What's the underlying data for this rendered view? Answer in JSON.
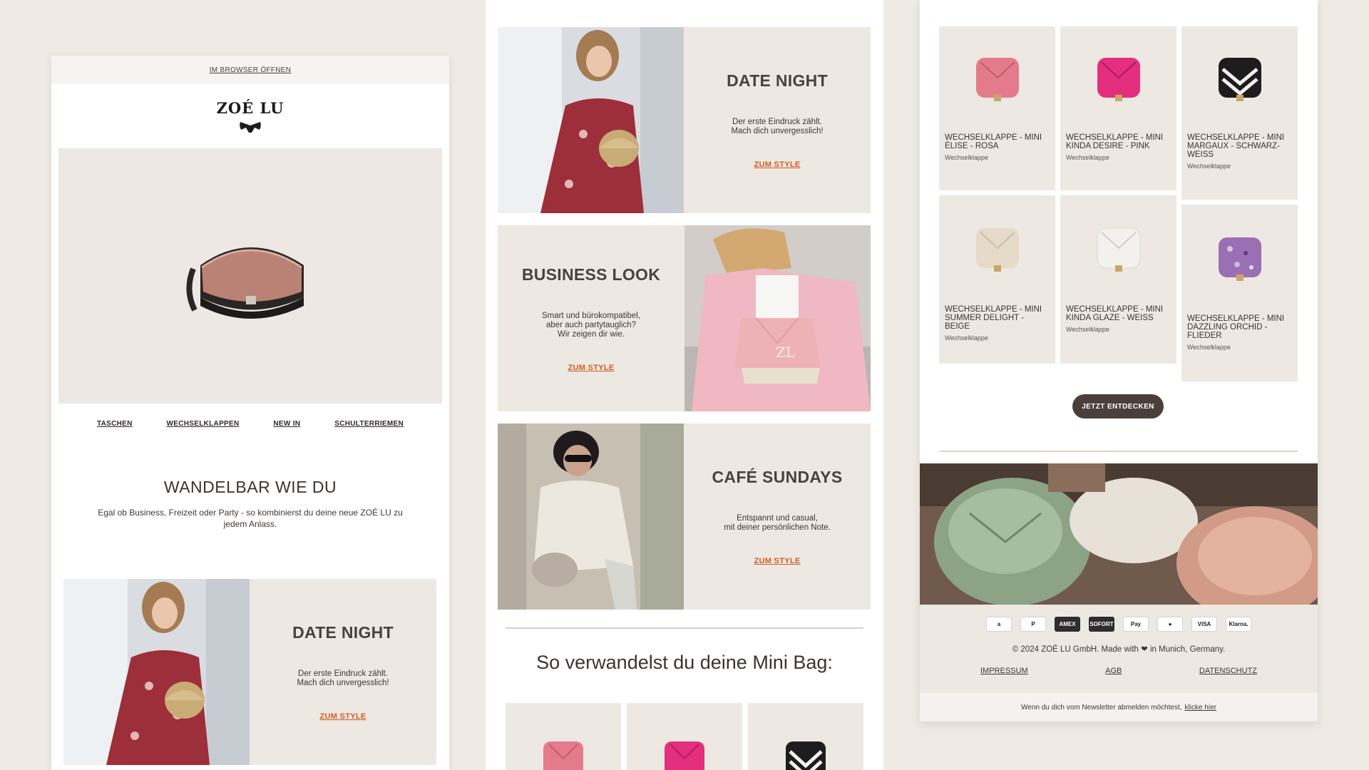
{
  "left": {
    "browser_link": "IM BROWSER ÖFFNEN",
    "logo": "ZOÉ LU",
    "nav": [
      "TASCHEN",
      "WECHSELKLAPPEN",
      "NEW IN",
      "SCHULTERRIEMEN"
    ],
    "intro_title": "WANDELBAR WIE DU",
    "intro_text": "Egal ob Business, Freizeit oder Party - so kombinierst du deine neue ZOÉ LU zu jedem Anlass.",
    "date_night": {
      "title": "DATE NIGHT",
      "text": "Der erste Eindruck zählt.\nMach dich unvergesslich!",
      "link": "ZUM STYLE"
    }
  },
  "middle": {
    "blocks": [
      {
        "title": "DATE NIGHT",
        "text": "Der erste Eindruck zählt.\nMach dich unvergesslich!",
        "link": "ZUM STYLE"
      },
      {
        "title": "BUSINESS LOOK",
        "text": "Smart und bürokompatibel,\naber auch partytauglich?\nWir zeigen dir wie.",
        "link": "ZUM STYLE"
      },
      {
        "title": "CAFÉ SUNDAYS",
        "text": "Entspannt und casual,\nmit deiner persönlichen Note.",
        "link": "ZUM STYLE"
      }
    ],
    "heading": "So verwandelst du deine Mini Bag:"
  },
  "right": {
    "products": [
      {
        "name": "WECHSELKLAPPE - MINI ÉLISE - ROSA",
        "category": "Wechselklappe",
        "color": "#e47b8c"
      },
      {
        "name": "WECHSELKLAPPE - MINI KINDA DESIRE - PINK",
        "category": "Wechselklappe",
        "color": "#e32f7e"
      },
      {
        "name": "WECHSELKLAPPE - MINI MARGAUX - SCHWARZ-WEISS",
        "category": "Wechselklappe",
        "color": "#1d1d1d"
      },
      {
        "name": "WECHSELKLAPPE - MINI SUMMER DELIGHT - BEIGE",
        "category": "Wechselklappe",
        "color": "#e6dac9"
      },
      {
        "name": "WECHSELKLAPPE - MINI KINDA GLAZE - WEISS",
        "category": "Wechselklappe",
        "color": "#f3f1ee"
      },
      {
        "name": "WECHSELKLAPPE - MINI DAZZLING ORCHID - FLIEDER",
        "category": "Wechselklappe",
        "color": "#9a6fb4"
      }
    ],
    "cta": "JETZT ENTDECKEN",
    "payments": [
      "a",
      "P",
      "AMEX",
      "SOFORT",
      "Pay",
      "●",
      "VISA",
      "Klarna."
    ],
    "copyright": "© 2024 ZOÉ LU GmbH. Made with ❤ in Munich, Germany.",
    "footer_links": [
      "IMPRESSUM",
      "AGB",
      "DATENSCHUTZ"
    ],
    "unsubscribe_text": "Wenn du dich vom Newsletter abmelden möchtest,",
    "unsubscribe_link": "klicke hier"
  }
}
